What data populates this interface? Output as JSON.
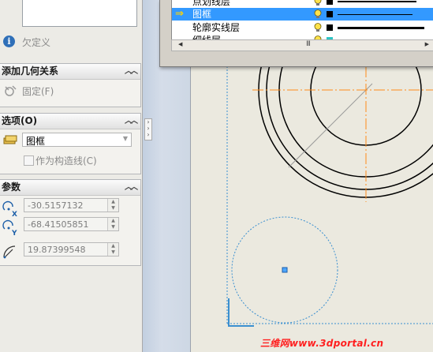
{
  "property_manager": {
    "undefined_status": "欠定义",
    "add_relations": {
      "title": "添加几何关系",
      "fix_label": "固定(F)"
    },
    "options": {
      "title": "选项(O)",
      "layer_value": "图框",
      "construction_label": "作为构造线(C)"
    },
    "parameters": {
      "title": "参数",
      "center_x": "-30.5157132",
      "center_y": "-68.41505851",
      "radius": "19.87399548"
    }
  },
  "layer_dialog": {
    "rows": [
      {
        "name": "点划线层",
        "selected": false
      },
      {
        "name": "图框",
        "selected": true
      },
      {
        "name": "轮廓实线层",
        "selected": false
      },
      {
        "name": "细线层",
        "selected": false
      }
    ],
    "scroll_left": "◀",
    "scroll_mid": "III",
    "scroll_right": "▶"
  },
  "watermark": "三维网www.3dportal.cn",
  "colors": {
    "selection": "#3399ff",
    "sketch_orange": "#ff8c1a",
    "construction_blue": "#3a8fd0",
    "watermark_red": "#ff1f1f"
  }
}
